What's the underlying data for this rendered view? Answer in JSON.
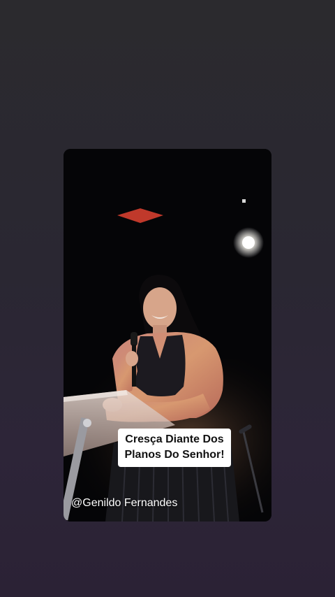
{
  "story": {
    "caption": {
      "line1": "Cresça Diante Dos",
      "line2": "Planos Do Senhor!"
    },
    "watermark": "@Genildo Fernandes"
  },
  "colors": {
    "background_top": "#2b2a2e",
    "background_bottom": "#2b2235",
    "caption_bg": "#ffffff",
    "caption_text": "#111111",
    "stage_light_accent": "#c0392b"
  }
}
